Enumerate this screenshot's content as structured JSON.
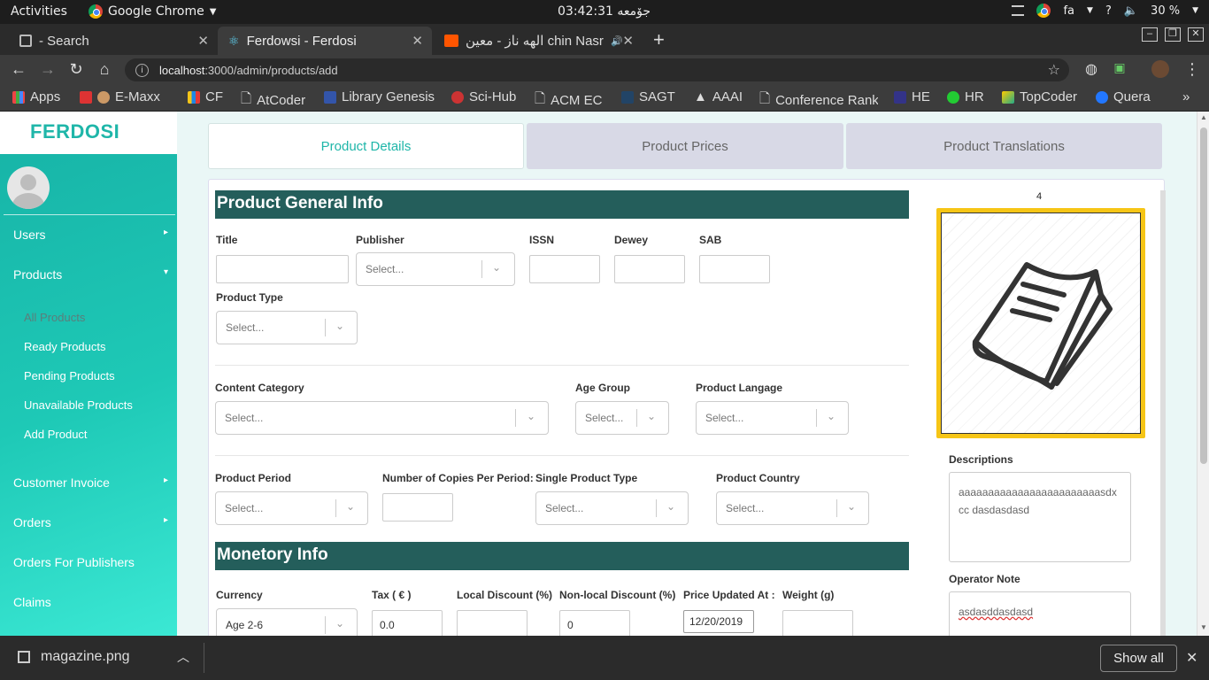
{
  "system_bar": {
    "activities": "Activities",
    "app_name": "Google Chrome",
    "clock": "03:42:31 جۆمعه",
    "lang": "fa",
    "help": "?",
    "battery": "30 %"
  },
  "tabs": [
    {
      "title": "- Search"
    },
    {
      "title": "Ferdowsi - Ferdosi"
    },
    {
      "title": "الهه ناز - معین chin Nasr"
    }
  ],
  "address": {
    "host": "localhost",
    "path": ":3000/admin/products/add"
  },
  "bookmarks": [
    "Apps",
    "E-Maxx",
    "CF",
    "AtCoder",
    "Library Genesis",
    "Sci-Hub",
    "ACM EC",
    "SAGT",
    "AAAI",
    "Conference Rank",
    "HE",
    "HR",
    "TopCoder",
    "Quera"
  ],
  "sidebar": {
    "logo": "FERDOSI",
    "items": [
      "Users",
      "Products",
      "Customer Invoice",
      "Orders",
      "Orders For Publishers",
      "Claims"
    ],
    "product_sub": [
      "All Products",
      "Ready Products",
      "Pending Products",
      "Unavailable Products",
      "Add Product"
    ]
  },
  "page_tabs": [
    "Product Details",
    "Product Prices",
    "Product Translations"
  ],
  "general": {
    "heading": "Product General Info",
    "title_label": "Title",
    "publisher_label": "Publisher",
    "issn_label": "ISSN",
    "dewey_label": "Dewey",
    "sab_label": "SAB",
    "product_type_label": "Product Type",
    "content_category_label": "Content Category",
    "age_group_label": "Age Group",
    "product_language_label": "Product Langage",
    "product_period_label": "Product Period",
    "copies_label": "Number of Copies Per Period:",
    "single_type_label": "Single Product Type",
    "country_label": "Product Country",
    "select_placeholder": "Select..."
  },
  "monetary": {
    "heading": "Monetory Info",
    "currency_label": "Currency",
    "currency_value": "Age 2-6",
    "tax_label": "Tax ( € )",
    "tax_value": "0.0",
    "local_discount_label": "Local Discount (%)",
    "nonlocal_discount_label": "Non-local Discount (%)",
    "nonlocal_discount_value": "0",
    "price_updated_label": "Price Updated At :",
    "price_updated_value": "12/20/2019",
    "weight_label": "Weight (g)"
  },
  "right_panel": {
    "image_counter": "4",
    "descriptions_label": "Descriptions",
    "descriptions_value": "aaaaaaaaaaaaaaaaaaaaaaaasdxcc dasdasdasd",
    "operator_note_label": "Operator Note",
    "operator_note_value": "asdasddasdasd"
  },
  "download_bar": {
    "file": "magazine.png",
    "show_all": "Show all"
  },
  "colors": {
    "accent": "#1fb6a9",
    "section_header": "#245e5b",
    "image_border": "#f6c516"
  }
}
